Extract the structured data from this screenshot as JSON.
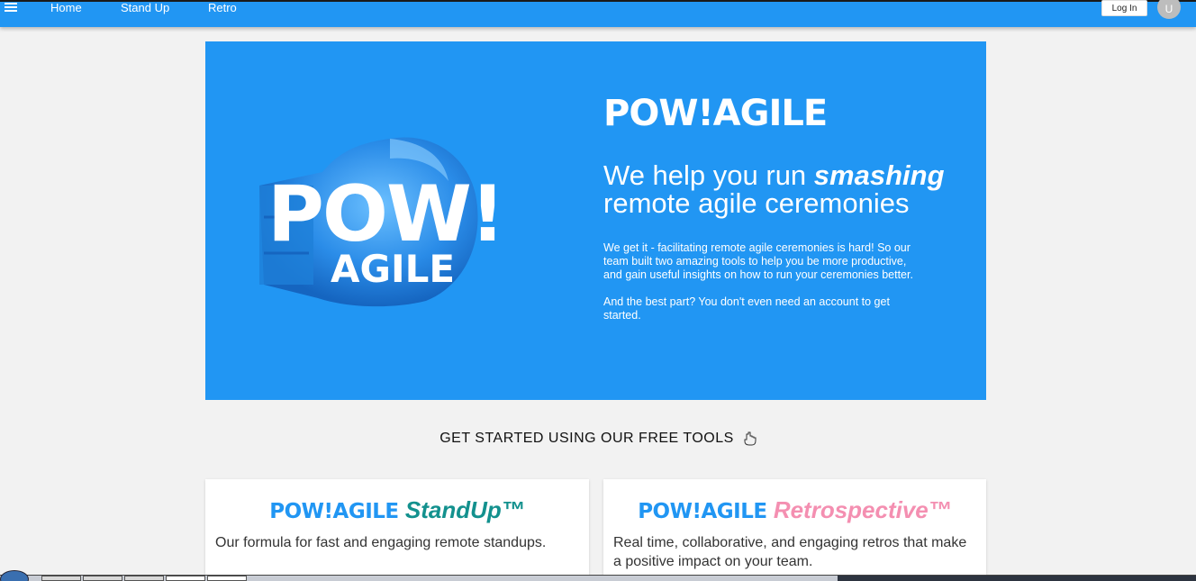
{
  "nav": {
    "links": [
      "Home",
      "Stand Up",
      "Retro"
    ],
    "login_label": "Log In",
    "avatar_initial": "U"
  },
  "hero": {
    "logo_pow": "POW!",
    "logo_agile": "AGILE",
    "brand_title": "POW!AGILE",
    "tagline_pre": "We help you run ",
    "tagline_emph": "smashing",
    "tagline_post": "remote agile ceremonies",
    "paragraph1": "We get it - facilitating remote agile ceremonies is hard! So our team built two amazing tools to help you be more productive, and gain useful insights on how to run your ceremonies better.",
    "paragraph2": "And the best part? You don't even need an account to get started."
  },
  "tools": {
    "heading": "GET STARTED USING OUR FREE TOOLS",
    "cards": [
      {
        "brand": "POW!AGILE",
        "product": "StandUp™",
        "product_color": "#13918e",
        "description": "Our formula for fast and engaging remote standups."
      },
      {
        "brand": "POW!AGILE",
        "product": "Retrospective™",
        "product_color": "#f48fb1",
        "description": "Real time, collaborative, and engaging retros that make a positive impact on your team."
      }
    ]
  },
  "colors": {
    "primary": "#2196f3",
    "background": "#f2f2f2"
  }
}
